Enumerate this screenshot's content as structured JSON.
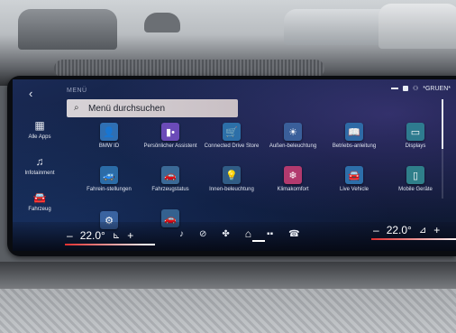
{
  "nav": {
    "back_glyph": "‹",
    "items": [
      {
        "label": "Alle Apps",
        "icon": "grid-icon",
        "glyph": "▦"
      },
      {
        "label": "Infotainment",
        "icon": "music-note-icon",
        "glyph": "♫"
      },
      {
        "label": "Fahrzeug",
        "icon": "car-icon",
        "glyph": "🚘"
      }
    ]
  },
  "menu": {
    "title": "MENÜ",
    "search_placeholder": "Menü durchsuchen"
  },
  "status": {
    "profile": "*GRUEN*"
  },
  "apps": [
    {
      "label": "BMW ID",
      "icon": "bmw-id-icon",
      "color": "#2f6fb3",
      "glyph": "👤"
    },
    {
      "label": "Persönlicher Assistent",
      "icon": "assistant-icon",
      "color": "#6b4bb8",
      "glyph": "▮•"
    },
    {
      "label": "Connected Drive Store",
      "icon": "store-icon",
      "color": "#2c6fa8",
      "glyph": "🛒"
    },
    {
      "label": "Außen-beleuchtung",
      "icon": "exterior-light-icon",
      "color": "#3a5f9a",
      "glyph": "☀"
    },
    {
      "label": "Betriebs-anleitung",
      "icon": "manual-icon",
      "color": "#2e6aa6",
      "glyph": "📖"
    },
    {
      "label": "Displays",
      "icon": "display-icon",
      "color": "#2e7b8f",
      "glyph": "▭"
    },
    {
      "label": "Fahrein-stellungen",
      "icon": "drive-settings-icon",
      "color": "#2b6ca7",
      "glyph": "🚙"
    },
    {
      "label": "Fahrzeugstatus",
      "icon": "vehicle-status-icon",
      "color": "#3b6996",
      "glyph": "🚗"
    },
    {
      "label": "Innen-beleuchtung",
      "icon": "interior-light-icon",
      "color": "#305c85",
      "glyph": "💡"
    },
    {
      "label": "Klimakomfort",
      "icon": "climate-icon",
      "color": "#b23a6e",
      "glyph": "❄"
    },
    {
      "label": "Live Vehicle",
      "icon": "live-vehicle-icon",
      "color": "#2d6ea9",
      "glyph": "🚘"
    },
    {
      "label": "Mobile Geräte",
      "icon": "mobile-devices-icon",
      "color": "#2f7f8a",
      "glyph": "▯"
    },
    {
      "label": "",
      "icon": "more-settings-icon",
      "color": "#3a63a0",
      "glyph": "⚙"
    },
    {
      "label": "",
      "icon": "car-connect-icon",
      "color": "#34618f",
      "glyph": "🚗"
    }
  ],
  "climate": {
    "minus": "–",
    "plus": "+",
    "left_temp": "22.0°",
    "right_temp": "22.0°",
    "controls": [
      {
        "icon": "music-icon",
        "glyph": "♪"
      },
      {
        "icon": "nav-icon",
        "glyph": "⊘"
      },
      {
        "icon": "fan-icon",
        "glyph": "✤"
      },
      {
        "icon": "home-icon",
        "glyph": "⌂"
      },
      {
        "icon": "apps-icon",
        "glyph": "▪▪"
      },
      {
        "icon": "phone-icon",
        "glyph": "☎"
      }
    ]
  }
}
